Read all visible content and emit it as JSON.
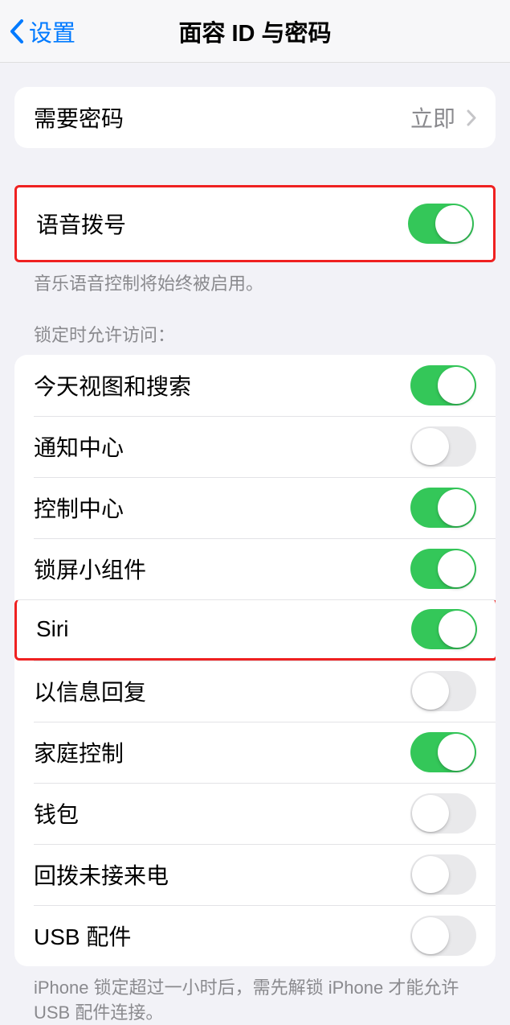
{
  "nav": {
    "back_label": "设置",
    "title": "面容 ID 与密码"
  },
  "passcode_group": {
    "require_passcode": {
      "label": "需要密码",
      "value": "立即"
    }
  },
  "voice_dial": {
    "label": "语音拨号",
    "note": "音乐语音控制将始终被启用。",
    "on": true
  },
  "locked_access": {
    "header": "锁定时允许访问：",
    "items": [
      {
        "label": "今天视图和搜索",
        "on": true
      },
      {
        "label": "通知中心",
        "on": false
      },
      {
        "label": "控制中心",
        "on": true
      },
      {
        "label": "锁屏小组件",
        "on": true
      },
      {
        "label": "Siri",
        "on": true
      },
      {
        "label": "以信息回复",
        "on": false
      },
      {
        "label": "家庭控制",
        "on": true
      },
      {
        "label": "钱包",
        "on": false
      },
      {
        "label": "回拨未接来电",
        "on": false
      },
      {
        "label": "USB 配件",
        "on": false
      }
    ],
    "usb_note": "iPhone 锁定超过一小时后，需先解锁 iPhone 才能允许 USB 配件连接。"
  }
}
